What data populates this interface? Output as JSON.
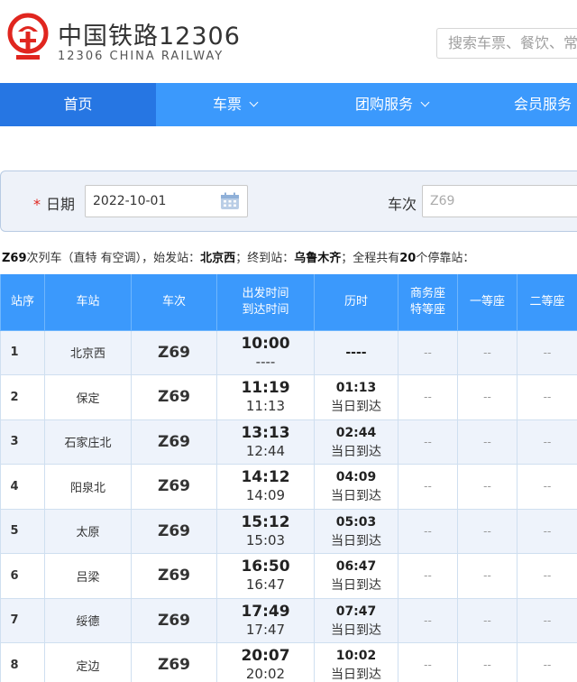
{
  "header": {
    "brand_cn": "中国铁路12306",
    "brand_en": "12306 CHINA RAILWAY",
    "search_placeholder": "搜索车票、餐饮、常"
  },
  "nav": {
    "items": [
      {
        "label": "首页",
        "active": true
      },
      {
        "label": "车票",
        "dropdown": true
      },
      {
        "label": "团购服务",
        "dropdown": true
      },
      {
        "label": "会员服务"
      }
    ]
  },
  "query": {
    "required_mark": "*",
    "date_label": "日期",
    "date_value": "2022-10-01",
    "train_label": "车次",
    "train_placeholder": "Z69"
  },
  "summary": {
    "train": "Z69",
    "t1": "次列车（直特 有空调），始发站：",
    "origin": "北京西",
    "t2": "；终到站：",
    "terminal": "乌鲁木齐",
    "t3": "；全程共有",
    "stop_count": "20",
    "t4": "个停靠站："
  },
  "table": {
    "headers": {
      "seq": "站序",
      "station": "车站",
      "train": "车次",
      "time_1": "出发时间",
      "time_2": "到达时间",
      "duration": "历时",
      "biz_1": "商务座",
      "biz_2": "特等座",
      "first": "一等座",
      "second": "二等座"
    },
    "rows": [
      {
        "seq": "1",
        "station": "北京西",
        "train": "Z69",
        "dep": "10:00",
        "arr": "----",
        "dur": "----",
        "dur_note": "",
        "biz": "--",
        "first": "--",
        "second": "--"
      },
      {
        "seq": "2",
        "station": "保定",
        "train": "Z69",
        "dep": "11:19",
        "arr": "11:13",
        "dur": "01:13",
        "dur_note": "当日到达",
        "biz": "--",
        "first": "--",
        "second": "--"
      },
      {
        "seq": "3",
        "station": "石家庄北",
        "train": "Z69",
        "dep": "13:13",
        "arr": "12:44",
        "dur": "02:44",
        "dur_note": "当日到达",
        "biz": "--",
        "first": "--",
        "second": "--"
      },
      {
        "seq": "4",
        "station": "阳泉北",
        "train": "Z69",
        "dep": "14:12",
        "arr": "14:09",
        "dur": "04:09",
        "dur_note": "当日到达",
        "biz": "--",
        "first": "--",
        "second": "--"
      },
      {
        "seq": "5",
        "station": "太原",
        "train": "Z69",
        "dep": "15:12",
        "arr": "15:03",
        "dur": "05:03",
        "dur_note": "当日到达",
        "biz": "--",
        "first": "--",
        "second": "--"
      },
      {
        "seq": "6",
        "station": "吕梁",
        "train": "Z69",
        "dep": "16:50",
        "arr": "16:47",
        "dur": "06:47",
        "dur_note": "当日到达",
        "biz": "--",
        "first": "--",
        "second": "--"
      },
      {
        "seq": "7",
        "station": "绥德",
        "train": "Z69",
        "dep": "17:49",
        "arr": "17:47",
        "dur": "07:47",
        "dur_note": "当日到达",
        "biz": "--",
        "first": "--",
        "second": "--"
      },
      {
        "seq": "8",
        "station": "定边",
        "train": "Z69",
        "dep": "20:07",
        "arr": "20:02",
        "dur": "10:02",
        "dur_note": "当日到达",
        "biz": "--",
        "first": "--",
        "second": "--"
      }
    ]
  },
  "colors": {
    "nav_bg": "#3b99fc",
    "nav_active": "#2676e3",
    "logo_red": "#e0261f",
    "row_alt": "#eef3fb"
  },
  "icons": {
    "logo": "china-railway-logo",
    "calendar": "calendar-icon",
    "nav_dropdown": "chevron-down-icon"
  }
}
